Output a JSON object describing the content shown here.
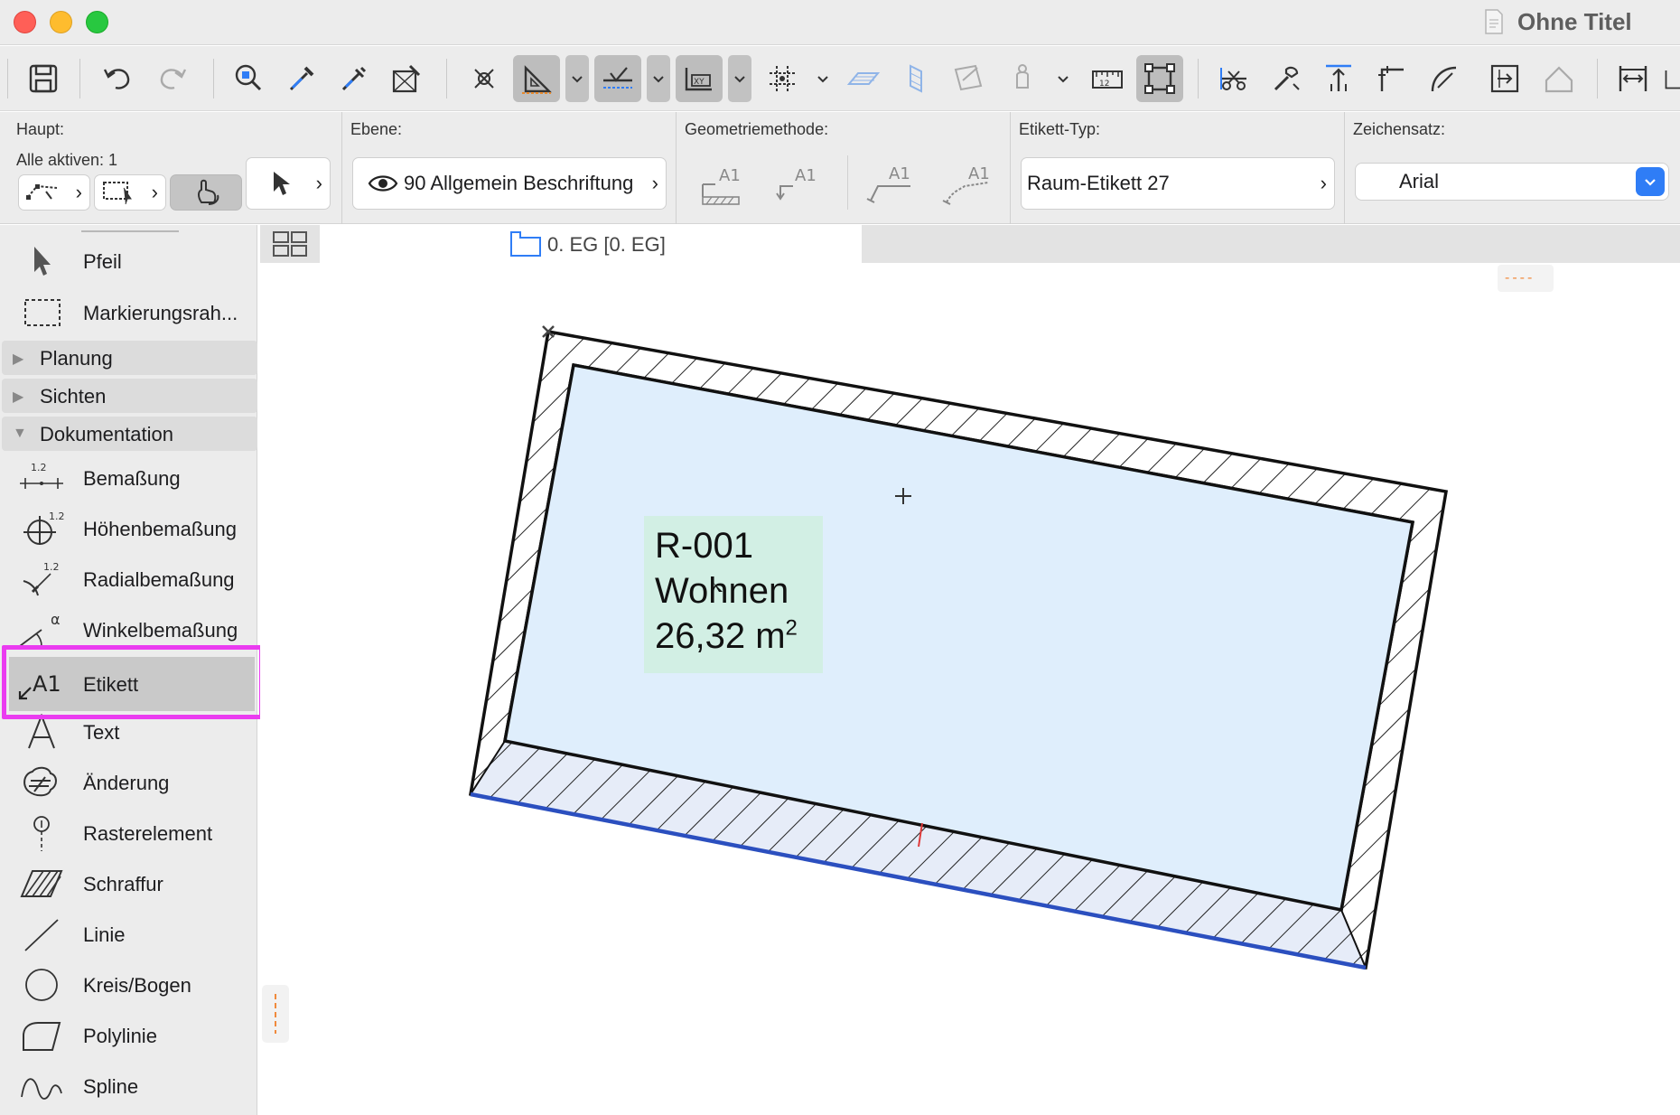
{
  "window": {
    "title": "Ohne Titel"
  },
  "infobox": {
    "haupt_label": "Haupt:",
    "alle_aktiven": "Alle aktiven: 1",
    "ebene_label": "Ebene:",
    "ebene_value": "90 Allgemein Beschriftung",
    "geometrie_label": "Geometriemethode:",
    "etikett_typ_label": "Etikett-Typ:",
    "etikett_typ_value": "Raum-Etikett 27",
    "zeichensatz_label": "Zeichensatz:",
    "zeichensatz_value": "Arial",
    "geometry_icon_text": "A1"
  },
  "sidebar": {
    "top_items": [
      {
        "label": "Pfeil",
        "icon": "arrow-pointer-icon"
      },
      {
        "label": "Markierungsrah...",
        "icon": "marquee-icon"
      }
    ],
    "groups": [
      {
        "label": "Planung",
        "expanded": false
      },
      {
        "label": "Sichten",
        "expanded": false
      },
      {
        "label": "Dokumentation",
        "expanded": true
      }
    ],
    "doc_items": [
      {
        "label": "Bemaßung",
        "icon": "dimension-icon"
      },
      {
        "label": "Höhenbemaßung",
        "icon": "level-dimension-icon"
      },
      {
        "label": "Radialbemaßung",
        "icon": "radial-dimension-icon"
      },
      {
        "label": "Winkelbemaßung",
        "icon": "angle-dimension-icon"
      },
      {
        "label": "Etikett",
        "icon": "label-icon",
        "selected": true
      },
      {
        "label": "Text",
        "icon": "text-icon"
      },
      {
        "label": "Änderung",
        "icon": "change-icon"
      },
      {
        "label": "Rasterelement",
        "icon": "grid-element-icon"
      },
      {
        "label": "Schraffur",
        "icon": "fill-hatch-icon"
      },
      {
        "label": "Linie",
        "icon": "line-icon"
      },
      {
        "label": "Kreis/Bogen",
        "icon": "circle-arc-icon"
      },
      {
        "label": "Polylinie",
        "icon": "polyline-icon"
      },
      {
        "label": "Spline",
        "icon": "spline-icon"
      }
    ],
    "icon_numbers": {
      "dim": "1.2",
      "alpha": "α",
      "etikett": "A1"
    }
  },
  "view": {
    "tab_label": "0. EG [0. EG]"
  },
  "room": {
    "id": "R-001",
    "name": "Wohnen",
    "area": "26,32 m",
    "area_sup": "2"
  },
  "colors": {
    "accent": "#2f7df6",
    "highlight": "#ea3bf0",
    "room_fill": "#dfeefc",
    "label_fill": "#d2efe4",
    "selected_edge": "#2b4fbf",
    "traffic_close": "#ff5f57",
    "traffic_min": "#febc2e",
    "traffic_max": "#28c840"
  }
}
